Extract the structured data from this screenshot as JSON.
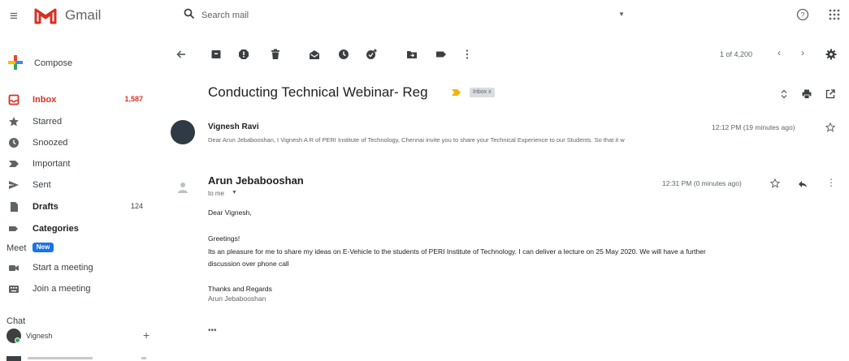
{
  "app": {
    "name": "Gmail"
  },
  "search": {
    "placeholder": "Search mail"
  },
  "sidebar": {
    "compose_label": "Compose",
    "items": [
      {
        "label": "Inbox",
        "count": "1,587"
      },
      {
        "label": "Starred",
        "count": ""
      },
      {
        "label": "Snoozed",
        "count": ""
      },
      {
        "label": "Important",
        "count": ""
      },
      {
        "label": "Sent",
        "count": ""
      },
      {
        "label": "Drafts",
        "count": "124"
      },
      {
        "label": "Categories",
        "count": ""
      }
    ],
    "meet": {
      "title": "Meet",
      "badge": "New",
      "items": [
        {
          "label": "Start a meeting"
        },
        {
          "label": "Join a meeting"
        }
      ]
    },
    "chat": {
      "title": "Chat",
      "contact": "Vignesh"
    }
  },
  "toolbar": {
    "page_count": "1 of 4,200"
  },
  "thread": {
    "subject": "Conducting Technical Webinar- Reg",
    "label": "Inbox x",
    "messages": [
      {
        "sender": "Vignesh Ravi",
        "time": "12:12 PM (19 minutes ago)",
        "snippet": "Dear Arun Jebabooshan, I Vignesh A R of PERI Institute of Technology, Chennai invite you to share your Technical Experience to our Students. So that it w"
      },
      {
        "sender": "Arun Jebabooshan",
        "to": "to me",
        "time": "12:31 PM (0 minutes ago)",
        "body": [
          "Dear Vignesh,",
          "Greetings!",
          "Its an pleasure for me to share my ideas on E-Vehicle to the students of PERI Institute of Technology. I can deliver a lecture on 25 May 2020. We will have a further",
          "discussion over phone call",
          "Thanks and Regards",
          "Arun Jebabooshan"
        ]
      }
    ]
  },
  "colors": {
    "accent_red": "#d93025",
    "badge_blue": "#1a73e8",
    "important_yellow": "#f4b400"
  }
}
